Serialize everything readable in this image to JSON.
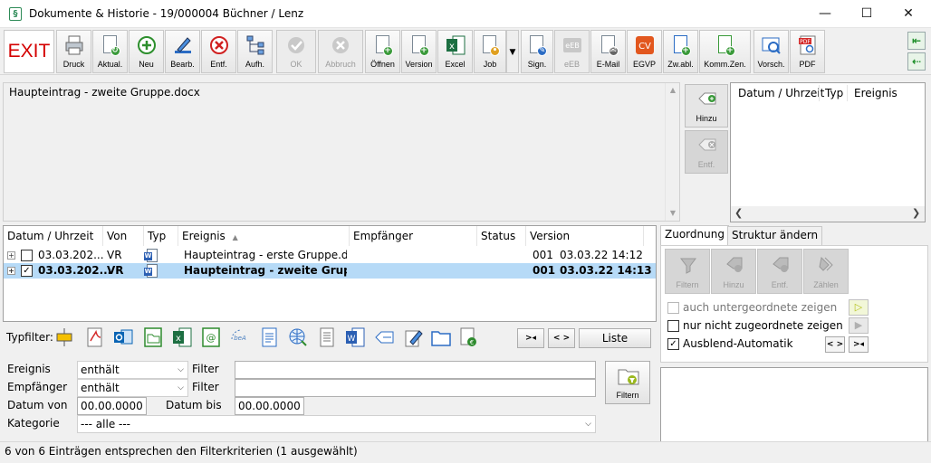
{
  "window": {
    "title": "Dokumente & Historie - 19/000004  Büchner / Lenz",
    "minimize": "—",
    "maximize": "☐",
    "close": "✕"
  },
  "toolbar": {
    "exit": "EXIT",
    "buttons": [
      {
        "label": "Druck",
        "icon": "printer-icon"
      },
      {
        "label": "Aktual.",
        "icon": "refresh-icon"
      },
      {
        "label": "Neu",
        "icon": "plus-icon"
      },
      {
        "label": "Bearb.",
        "icon": "pencil-icon"
      },
      {
        "label": "Entf.",
        "icon": "delete-icon"
      },
      {
        "label": "Aufh.",
        "icon": "hierarchy-icon"
      },
      {
        "label": "OK",
        "icon": "check-icon"
      },
      {
        "label": "Abbruch",
        "icon": "cancel-icon"
      },
      {
        "label": "Öffnen",
        "icon": "open-doc-icon"
      },
      {
        "label": "Version",
        "icon": "version-icon"
      },
      {
        "label": "Excel",
        "icon": "excel-icon"
      },
      {
        "label": "Job",
        "icon": "job-icon"
      },
      {
        "label": "Sign.",
        "icon": "sign-icon"
      },
      {
        "label": "eEB",
        "icon": "eeb-icon"
      },
      {
        "label": "E-Mail",
        "icon": "email-icon"
      },
      {
        "label": "EGVP",
        "icon": "egvp-icon"
      },
      {
        "label": "Zw.abl.",
        "icon": "clipboard-icon"
      },
      {
        "label": "Komm.Zen.",
        "icon": "commzen-icon"
      },
      {
        "label": "Vorsch.",
        "icon": "preview-icon"
      },
      {
        "label": "PDF",
        "icon": "pdf-icon"
      }
    ],
    "cv_text": "CV",
    "eeb_text": "eEB",
    "pdf_text": "PDF"
  },
  "preview": {
    "filename": "Haupteintrag - zweite Gruppe.docx"
  },
  "side_buttons": {
    "hinzu": "Hinzu",
    "entf": "Entf."
  },
  "history_panel": {
    "headers": [
      "Datum / Uhrzeit",
      "Typ",
      "Ereignis"
    ]
  },
  "grid": {
    "headers": [
      "Datum / Uhrzeit",
      "Von",
      "Typ",
      "Ereignis",
      "Empfänger",
      "Status",
      "Version"
    ],
    "sort_indicator": "▲",
    "rows": [
      {
        "date": "03.03.202...",
        "von": "VR",
        "ereignis": "Haupteintrag - erste Gruppe.d...",
        "empfaenger": "",
        "status": "",
        "version": "001",
        "version_date": "03.03.22 14:12",
        "checked": "",
        "expander": "+"
      },
      {
        "date": "03.03.202...",
        "von": "VR",
        "ereignis": "Haupteintrag - zweite Gruppe....",
        "empfaenger": "",
        "status": "",
        "version": "001",
        "version_date": "03.03.22 14:13",
        "checked": "✓",
        "expander": "+"
      }
    ],
    "word_letter": "W"
  },
  "zuordnung": {
    "tabs": [
      "Zuordnung",
      "Struktur ändern"
    ],
    "buttons": [
      "Filtern",
      "Hinzu",
      "Entf.",
      "Zählen"
    ],
    "options": [
      {
        "label": "auch untergeordnete zeigen",
        "checked": "",
        "enabled": false
      },
      {
        "label": "nur nicht zugeordnete zeigen",
        "checked": "",
        "enabled": true
      },
      {
        "label": "Ausblend-Automatik",
        "checked": "✓",
        "enabled": true
      }
    ],
    "small_left": "< >",
    "small_right": ">◂"
  },
  "typfilter": {
    "label": "Typfilter:",
    "btn_collapse": ">◂",
    "btn_expand": "< >",
    "btn_liste": "Liste"
  },
  "filter": {
    "ereignis_label": "Ereignis",
    "ereignis_mode": "enthält",
    "empfaenger_label": "Empfänger",
    "empfaenger_mode": "enthält",
    "filter_label": "Filter",
    "datum_von_label": "Datum von",
    "datum_von": "00.00.0000",
    "datum_bis_label": "Datum bis",
    "datum_bis": "00.00.0000",
    "kategorie_label": "Kategorie",
    "kategorie": "--- alle ---",
    "filtern_btn": "Filtern"
  },
  "status": {
    "text": "6 von 6 Einträgen entsprechen den Filterkriterien (1 ausgewählt)"
  },
  "colors": {
    "selection": "#b6daf7",
    "exit_red": "#d40000",
    "accent_green": "#1e8f2a"
  }
}
